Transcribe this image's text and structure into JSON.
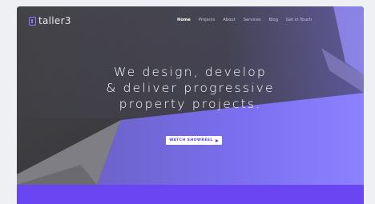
{
  "brand": {
    "name": "taller3",
    "accent": "#8c78ff"
  },
  "nav": {
    "items": [
      {
        "label": "Home",
        "active": true
      },
      {
        "label": "Projects",
        "active": false
      },
      {
        "label": "About",
        "active": false
      },
      {
        "label": "Services",
        "active": false
      },
      {
        "label": "Blog",
        "active": false
      },
      {
        "label": "Get in Touch",
        "active": false
      }
    ]
  },
  "hero": {
    "headline_lines": [
      "We design, develop",
      "& deliver progressive",
      "property projects."
    ],
    "cta_label": "WATCH SHOWREEL",
    "cta_icon": "play-icon"
  },
  "colors": {
    "hero_dark": "#3f3f42",
    "purple": "#6a45f2",
    "cta_text": "#5a3fe0"
  }
}
